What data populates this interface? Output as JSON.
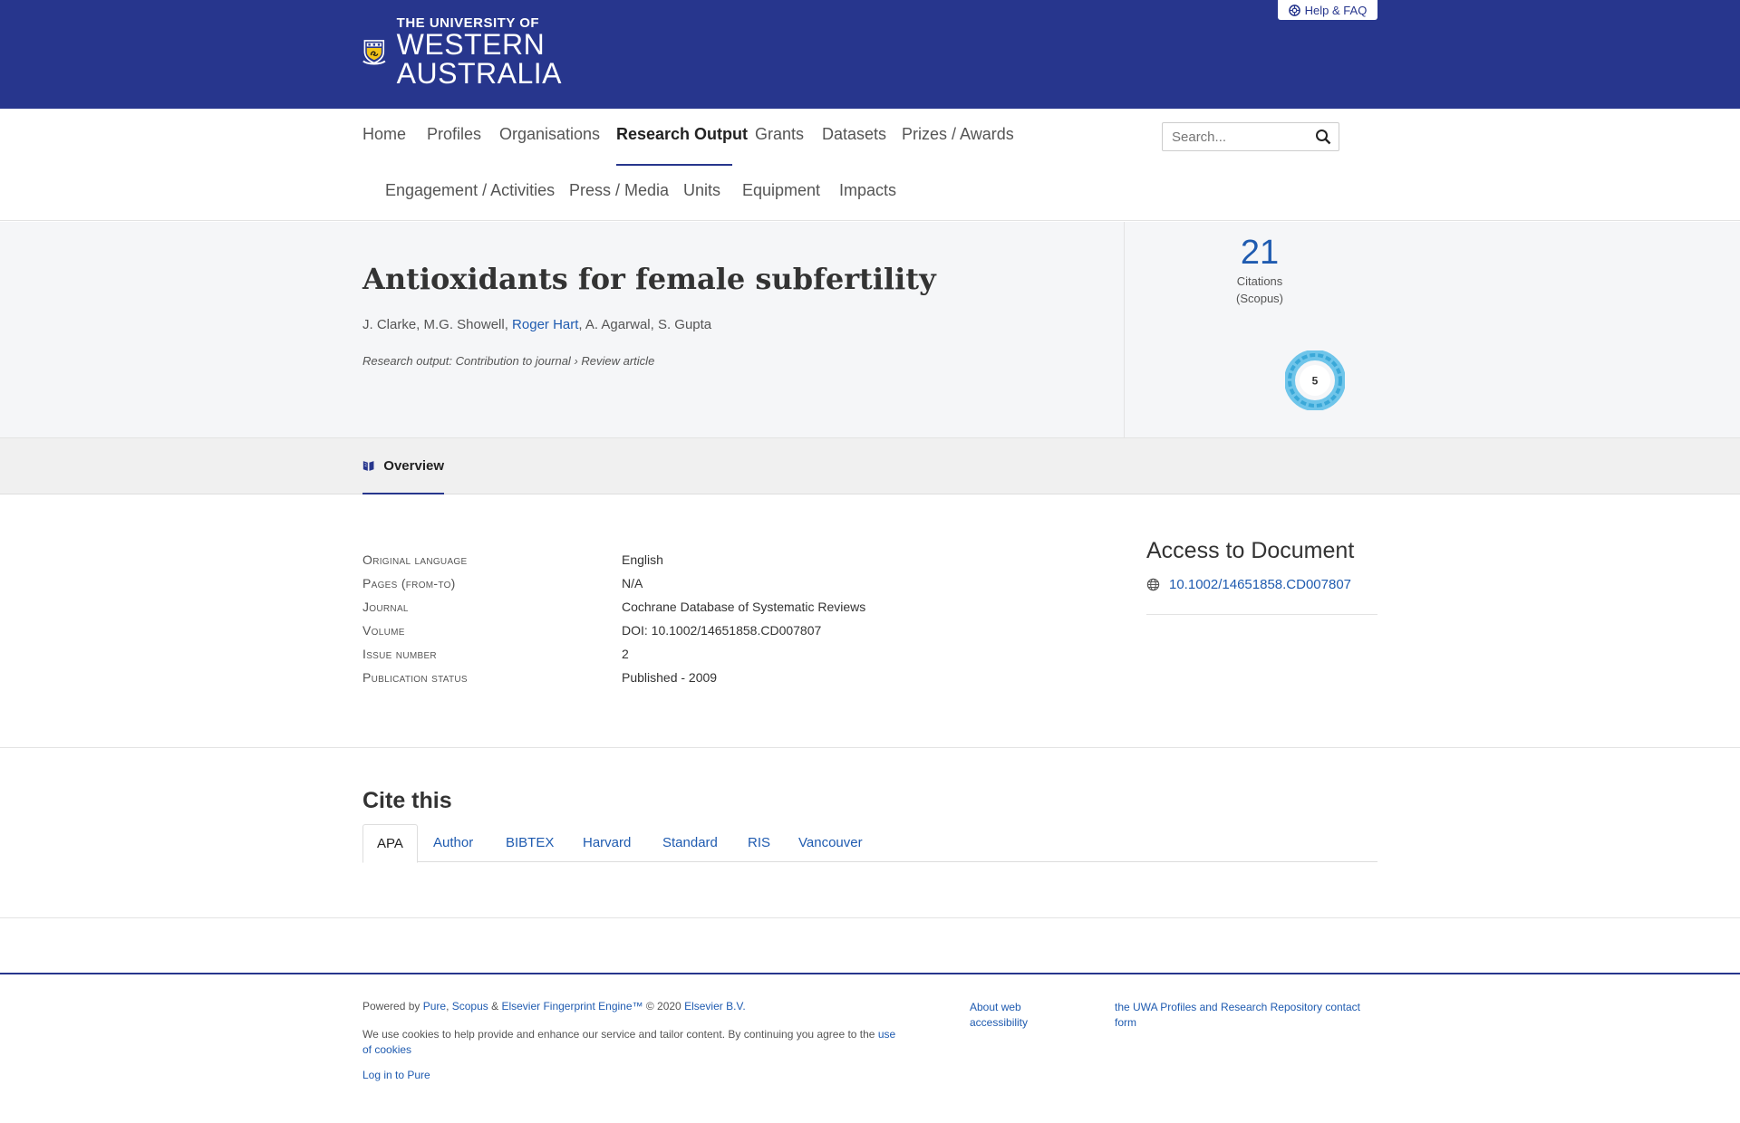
{
  "header": {
    "logo_line1": "THE UNIVERSITY OF",
    "logo_line2": "WESTERN",
    "logo_line3": "AUSTRALIA",
    "help_label": "Help & FAQ",
    "brand_color": "#27368d"
  },
  "nav": {
    "items": [
      "Home",
      "Profiles",
      "Organisations",
      "Research Output",
      "Grants",
      "Datasets",
      "Prizes / Awards",
      "Engagement / Activities",
      "Press / Media",
      "Units",
      "Equipment",
      "Impacts"
    ],
    "active": "Research Output",
    "search_placeholder": "Search..."
  },
  "output": {
    "title": "Antioxidants for female subfertility",
    "authors_before": "J. Clarke, M.G. Showell, ",
    "author_link": "Roger Hart",
    "authors_after": ", A. Agarwal, S. Gupta",
    "type_prefix": "Research output",
    "type_main": ": Contribution to journal",
    "type_sep": " › ",
    "type_sub": "Review article",
    "citations_count": "21",
    "citations_label": "Citations",
    "citations_source": "(Scopus)",
    "altmetric_score": "5"
  },
  "tabs": {
    "overview_label": "Overview"
  },
  "details": [
    {
      "key": "Original language",
      "value": "English"
    },
    {
      "key": "Pages (from-to)",
      "value": "N/A"
    },
    {
      "key": "Journal",
      "value": "Cochrane Database of Systematic Reviews"
    },
    {
      "key": "Volume",
      "value": "DOI: 10.1002/14651858.CD007807"
    },
    {
      "key": "Issue number",
      "value": "2"
    },
    {
      "key": "Publication status",
      "value": "Published - 2009"
    }
  ],
  "access": {
    "title": "Access to Document",
    "link": "10.1002/14651858.CD007807"
  },
  "cite": {
    "title": "Cite this",
    "tabs": [
      "APA",
      "Author",
      "BIBTEX",
      "Harvard",
      "Standard",
      "RIS",
      "Vancouver"
    ],
    "active": "APA"
  },
  "footer": {
    "powered_by": "Powered by ",
    "pure": "Pure",
    "comma": ", ",
    "scopus": "Scopus",
    "amp": " & ",
    "fingerprint": "Elsevier Fingerprint Engine™",
    "copyright": " © 2020 ",
    "elsevier": "Elsevier B.V.",
    "cookies_text": "We use cookies to help provide and enhance our service and tailor content. By continuing you agree to the ",
    "cookies_link": "use of cookies",
    "login": "Log in to Pure",
    "accessibility": "About web accessibility",
    "contact": "the UWA Profiles and Research Repository contact form"
  }
}
